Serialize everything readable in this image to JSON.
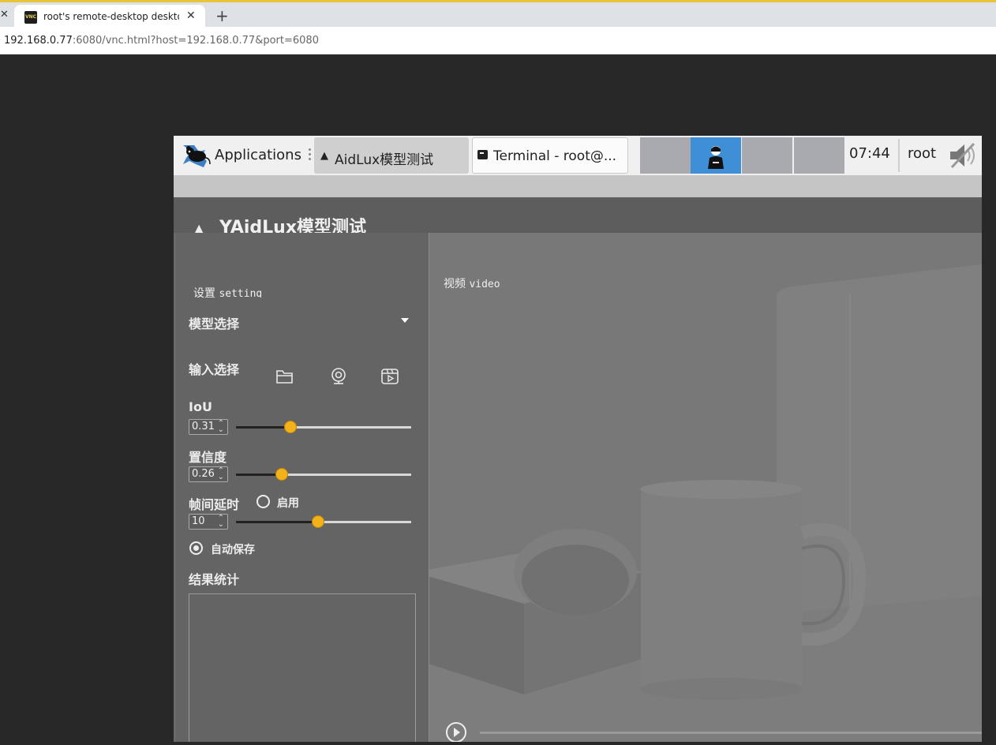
{
  "browser": {
    "tab_title": "root's remote-desktop desktop (vnc)",
    "favicon_text": "VNC",
    "tab_close": "✕",
    "left_close": "✕",
    "new_tab": "+",
    "url_host": "192.168.0.77",
    "url_rest": ":6080/vnc.html?host=192.168.0.77&port=6080"
  },
  "panel": {
    "applications_label": "Applications",
    "task1_label": "AidLux模型测试",
    "task2_label": "Terminal - root@...",
    "clock": "07:44",
    "user": "root"
  },
  "app": {
    "title": "YAidLux模型测试",
    "setting_cn": "设置",
    "setting_en": "setting",
    "model_label": "模型选择",
    "input_label": "输入选择",
    "iou_label": "IoU",
    "iou_value": "0.31",
    "iou_slider": 0.31,
    "conf_label": "置信度",
    "conf_value": "0.26",
    "conf_slider": 0.26,
    "delay_label": "帧间延时",
    "delay_enable": "启用",
    "delay_value": "10",
    "delay_slider": 0.47,
    "autosave_label": "自动保存",
    "results_label": "结果统计",
    "video_cn": "视频",
    "video_en": "video"
  },
  "colors": {
    "slider_knob": "#f3b11a",
    "workspace_active": "#3f8fd6"
  }
}
